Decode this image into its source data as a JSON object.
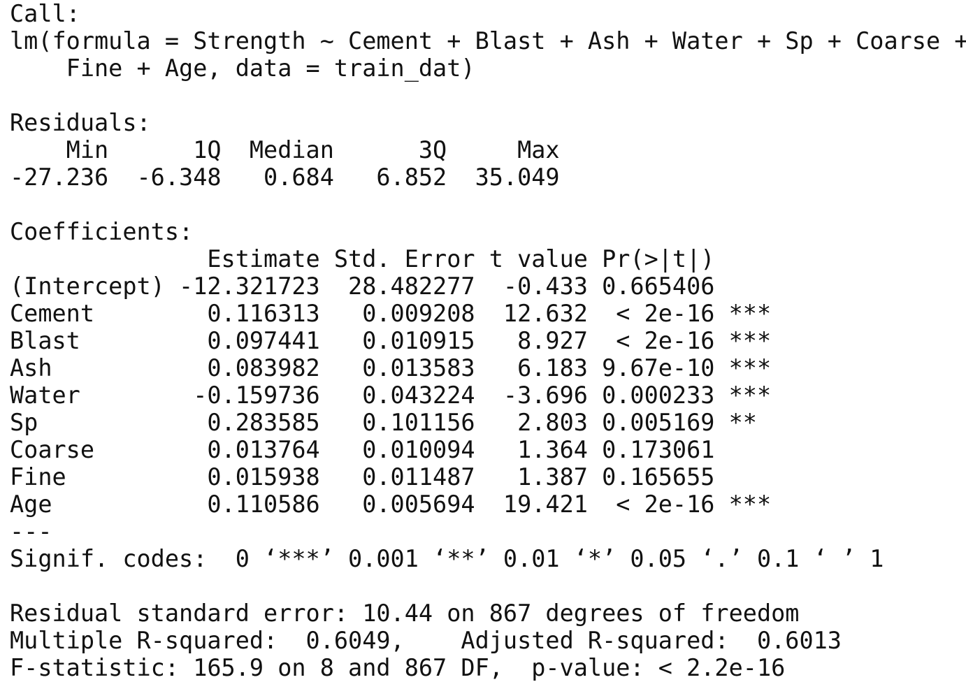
{
  "call": {
    "label": "Call:",
    "formula_line1": "lm(formula = Strength ~ Cement + Blast + Ash + Water + Sp + Coarse +",
    "formula_line2": "    Fine + Age, data = train_dat)"
  },
  "residuals": {
    "label": "Residuals:",
    "header_line": "    Min      1Q  Median      3Q     Max ",
    "values_line": "-27.236  -6.348   0.684   6.852  35.049 ",
    "columns": [
      "Min",
      "1Q",
      "Median",
      "3Q",
      "Max"
    ],
    "values": [
      "-27.236",
      "-6.348",
      "0.684",
      "6.852",
      "35.049"
    ]
  },
  "coefficients": {
    "label": "Coefficients:",
    "header_line": "              Estimate Std. Error t value Pr(>|t|)    ",
    "columns": [
      "Estimate",
      "Std. Error",
      "t value",
      "Pr(>|t|)"
    ],
    "rows": [
      {
        "line": "(Intercept) -12.321723  28.482277  -0.433 0.665406    ",
        "term": "(Intercept)",
        "estimate": "-12.321723",
        "std_error": "28.482277",
        "t_value": "-0.433",
        "p_value": "0.665406",
        "signif": ""
      },
      {
        "line": "Cement        0.116313   0.009208  12.632  < 2e-16 ***",
        "term": "Cement",
        "estimate": "0.116313",
        "std_error": "0.009208",
        "t_value": "12.632",
        "p_value": "< 2e-16",
        "signif": "***"
      },
      {
        "line": "Blast         0.097441   0.010915   8.927  < 2e-16 ***",
        "term": "Blast",
        "estimate": "0.097441",
        "std_error": "0.010915",
        "t_value": "8.927",
        "p_value": "< 2e-16",
        "signif": "***"
      },
      {
        "line": "Ash           0.083982   0.013583   6.183 9.67e-10 ***",
        "term": "Ash",
        "estimate": "0.083982",
        "std_error": "0.013583",
        "t_value": "6.183",
        "p_value": "9.67e-10",
        "signif": "***"
      },
      {
        "line": "Water        -0.159736   0.043224  -3.696 0.000233 ***",
        "term": "Water",
        "estimate": "-0.159736",
        "std_error": "0.043224",
        "t_value": "-3.696",
        "p_value": "0.000233",
        "signif": "***"
      },
      {
        "line": "Sp            0.283585   0.101156   2.803 0.005169 ** ",
        "term": "Sp",
        "estimate": "0.283585",
        "std_error": "0.101156",
        "t_value": "2.803",
        "p_value": "0.005169",
        "signif": "**"
      },
      {
        "line": "Coarse        0.013764   0.010094   1.364 0.173061    ",
        "term": "Coarse",
        "estimate": "0.013764",
        "std_error": "0.010094",
        "t_value": "1.364",
        "p_value": "0.173061",
        "signif": ""
      },
      {
        "line": "Fine          0.015938   0.011487   1.387 0.165655    ",
        "term": "Fine",
        "estimate": "0.015938",
        "std_error": "0.011487",
        "t_value": "1.387",
        "p_value": "0.165655",
        "signif": ""
      },
      {
        "line": "Age           0.110586   0.005694  19.421  < 2e-16 ***",
        "term": "Age",
        "estimate": "0.110586",
        "std_error": "0.005694",
        "t_value": "19.421",
        "p_value": "< 2e-16",
        "signif": "***"
      }
    ],
    "separator": "---",
    "signif_codes": "Signif. codes:  0 ‘***’ 0.001 ‘**’ 0.01 ‘*’ 0.05 ‘.’ 0.1 ‘ ’ 1"
  },
  "summary": {
    "residual_std_error": "Residual standard error: 10.44 on 867 degrees of freedom",
    "r_squared": "Multiple R-squared:  0.6049,\tAdjusted R-squared:  0.6013 ",
    "f_statistic": "F-statistic: 165.9 on 8 and 867 DF,  p-value: < 2.2e-16"
  }
}
